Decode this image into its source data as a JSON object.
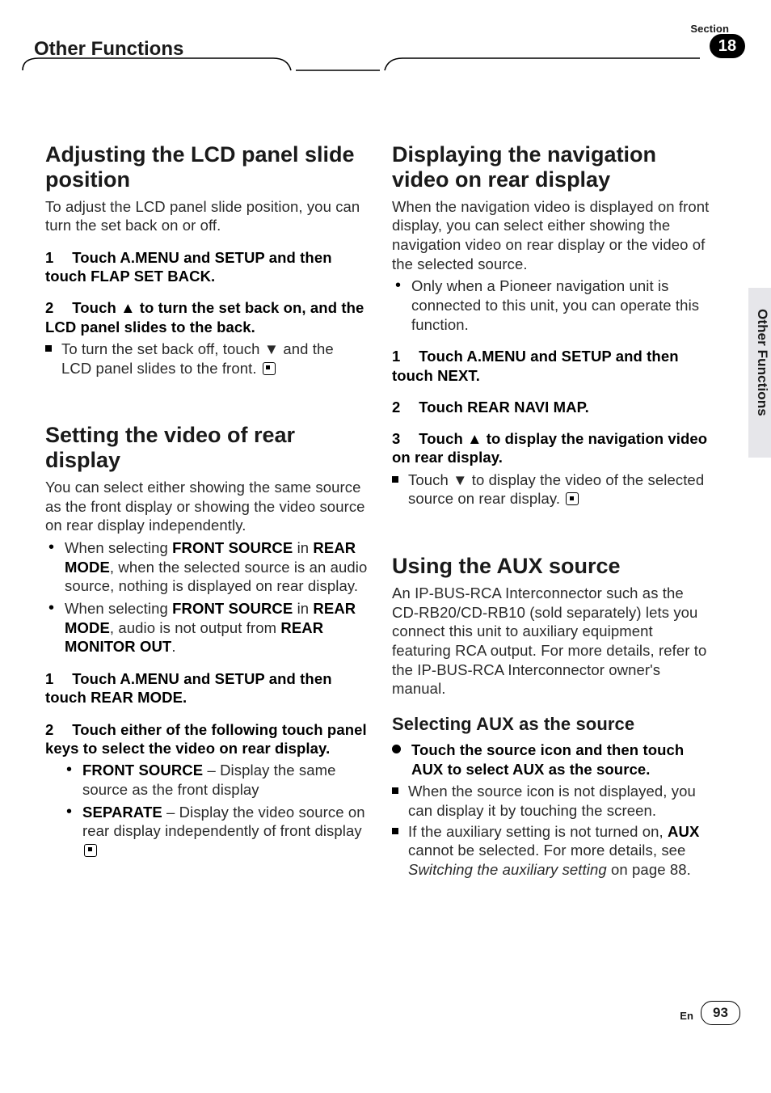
{
  "header": {
    "title": "Other Functions",
    "section_label": "Section",
    "section_number": "18"
  },
  "side_label": "Other Functions",
  "footer": {
    "lang": "En",
    "page": "93"
  },
  "col_left": {
    "t1_title": "Adjusting the LCD panel slide position",
    "t1_intro": "To adjust the LCD panel slide position, you can turn the set back on or off.",
    "t1_s1": "Touch A.MENU and SETUP and then touch FLAP SET BACK.",
    "t1_s2a": "Touch ▲ to turn the set back on, and the LCD panel slides to the back.",
    "t1_n1a": "To turn the set back off, touch ▼ and the LCD panel slides to the front.",
    "t2_title": "Setting the video of rear display",
    "t2_intro": "You can select either showing the same source as the front display or showing the video source on rear display independently.",
    "t2_b1_pre": "When selecting ",
    "t2_b1_kw1": "FRONT SOURCE",
    "t2_b1_mid": " in ",
    "t2_b1_kw2": "REAR MODE",
    "t2_b1_post": ", when the selected source is an audio source, nothing is displayed on rear display.",
    "t2_b2_pre": "When selecting ",
    "t2_b2_kw1": "FRONT SOURCE",
    "t2_b2_mid": " in ",
    "t2_b2_kw2": "REAR MODE",
    "t2_b2_post1": ", audio is not output from ",
    "t2_b2_kw3": "REAR MONITOR OUT",
    "t2_b2_post2": ".",
    "t2_s1": "Touch A.MENU and SETUP and then touch REAR MODE.",
    "t2_s2": "Touch either of the following touch panel keys to select the video on rear display.",
    "t2_opt1_kw": "FRONT SOURCE",
    "t2_opt1_txt": " – Display the same source as the front display",
    "t2_opt2_kw": "SEPARATE",
    "t2_opt2_txt": " – Display the video source on rear display independently of front display"
  },
  "col_right": {
    "t3_title": "Displaying the navigation video on rear display",
    "t3_intro": "When the navigation video is displayed on front display, you can select either showing the navigation video on rear display or the video of the selected source.",
    "t3_b1": "Only when a Pioneer navigation unit is connected to this unit, you can operate this function.",
    "t3_s1": "Touch A.MENU and SETUP and then touch NEXT.",
    "t3_s2": "Touch REAR NAVI MAP.",
    "t3_s3": "Touch ▲ to display the navigation video on rear display.",
    "t3_n1": "Touch ▼ to display the video of the selected source on rear display.",
    "t4_title": "Using the AUX source",
    "t4_intro": "An IP-BUS-RCA Interconnector such as the CD-RB20/CD-RB10 (sold separately) lets you connect this unit to auxiliary equipment featuring RCA output. For more details, refer to the IP-BUS-RCA Interconnector owner's manual.",
    "t4_sub": "Selecting AUX as the source",
    "t4_d1": "Touch the source icon and then touch AUX to select AUX as the source.",
    "t4_n1": "When the source icon is not displayed, you can display it by touching the screen.",
    "t4_n2a": "If the auxiliary setting is not turned on, ",
    "t4_n2kw": "AUX",
    "t4_n2b": " cannot be selected. For more details, see ",
    "t4_n2i": "Switching the auxiliary setting",
    "t4_n2c": " on page 88."
  }
}
